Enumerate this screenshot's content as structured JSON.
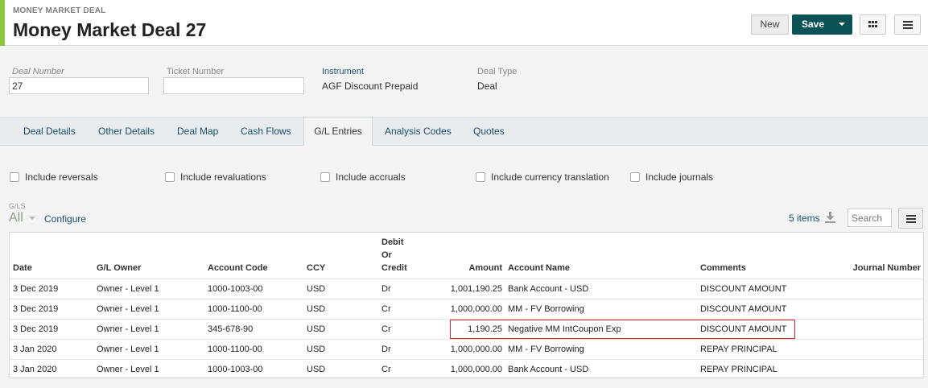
{
  "header": {
    "kicker": "MONEY MARKET DEAL",
    "title": "Money Market Deal 27",
    "new_label": "New",
    "save_label": "Save"
  },
  "fields": {
    "deal_number_label": "Deal Number",
    "deal_number_value": "27",
    "ticket_number_label": "Ticket Number",
    "ticket_number_value": "",
    "instrument_label": "Instrument",
    "instrument_value": "AGF Discount Prepaid",
    "deal_type_label": "Deal Type",
    "deal_type_value": "Deal"
  },
  "tabs": [
    {
      "label": "Deal Details",
      "active": false
    },
    {
      "label": "Other Details",
      "active": false
    },
    {
      "label": "Deal Map",
      "active": false
    },
    {
      "label": "Cash Flows",
      "active": false
    },
    {
      "label": "G/L Entries",
      "active": true
    },
    {
      "label": "Analysis Codes",
      "active": false
    },
    {
      "label": "Quotes",
      "active": false
    }
  ],
  "filters": [
    {
      "label": "Include reversals",
      "checked": false
    },
    {
      "label": "Include revaluations",
      "checked": false
    },
    {
      "label": "Include accruals",
      "checked": false
    },
    {
      "label": "Include currency translation",
      "checked": false
    },
    {
      "label": "Include journals",
      "checked": false
    }
  ],
  "list": {
    "view_label": "G/LS",
    "view_value": "All",
    "configure_label": "Configure",
    "items_count": "5 items",
    "search_placeholder": "Search"
  },
  "table": {
    "columns": {
      "date": "Date",
      "owner": "G/L Owner",
      "account_code": "Account Code",
      "ccy": "CCY",
      "dc_1": "Debit",
      "dc_2": "Or",
      "dc_3": "Credit",
      "amount": "Amount",
      "account_name": "Account Name",
      "comments": "Comments",
      "journal": "Journal Number"
    },
    "rows": [
      {
        "date": "3 Dec 2019",
        "owner": "Owner - Level 1",
        "account_code": "1000-1003-00",
        "ccy": "USD",
        "dc": "Dr",
        "amount": "1,001,190.25",
        "account_name": "Bank Account - USD",
        "comments": "DISCOUNT AMOUNT",
        "journal": ""
      },
      {
        "date": "3 Dec 2019",
        "owner": "Owner - Level 1",
        "account_code": "1000-1100-00",
        "ccy": "USD",
        "dc": "Cr",
        "amount": "1,000,000.00",
        "account_name": "MM - FV Borrowing",
        "comments": "DISCOUNT AMOUNT",
        "journal": ""
      },
      {
        "date": "3 Dec 2019",
        "owner": "Owner - Level 1",
        "account_code": "345-678-90",
        "ccy": "USD",
        "dc": "Cr",
        "amount": "1,190.25",
        "account_name": "Negative MM IntCoupon Exp",
        "comments": "DISCOUNT AMOUNT",
        "journal": ""
      },
      {
        "date": "3 Jan 2020",
        "owner": "Owner - Level 1",
        "account_code": "1000-1100-00",
        "ccy": "USD",
        "dc": "Dr",
        "amount": "1,000,000.00",
        "account_name": "MM - FV Borrowing",
        "comments": "REPAY PRINCIPAL",
        "journal": ""
      },
      {
        "date": "3 Jan 2020",
        "owner": "Owner - Level 1",
        "account_code": "1000-1003-00",
        "ccy": "USD",
        "dc": "Cr",
        "amount": "1,000,000.00",
        "account_name": "Bank Account - USD",
        "comments": "REPAY PRINCIPAL",
        "journal": ""
      }
    ]
  },
  "colors": {
    "accent": "#8cc63f",
    "primary": "#0b5257",
    "link": "#1a4f6e",
    "highlight": "#d9232e"
  }
}
